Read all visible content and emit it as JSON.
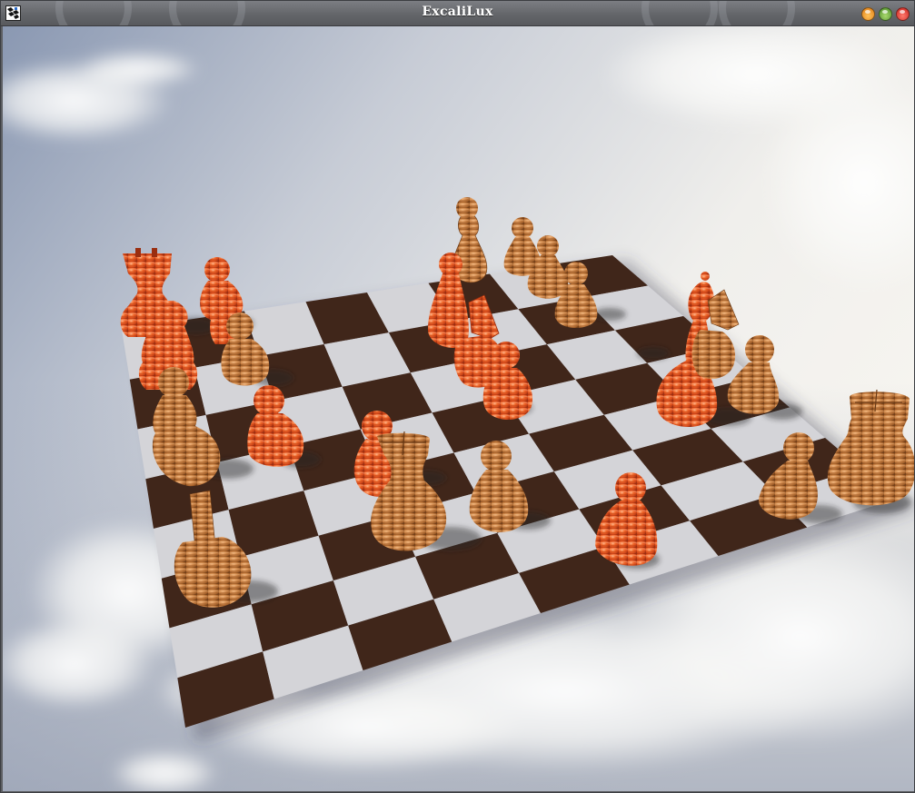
{
  "window": {
    "title": "ExcaliLux",
    "app_icon": "chessboard-app-icon",
    "controls": {
      "minimize": {
        "icon": "minimize-orb-icon",
        "color": "#f0a030"
      },
      "maximize": {
        "icon": "maximize-orb-icon",
        "color": "#6fb040"
      },
      "close": {
        "icon": "close-orb-icon",
        "color": "#e03a30"
      }
    }
  },
  "scene": {
    "board": {
      "dark_square_color": "#40261a",
      "light_square_color": "#d4d4d8"
    },
    "piece_colors": {
      "orange_side": "#ee5c22",
      "tan_side": "#c17a3a"
    }
  }
}
